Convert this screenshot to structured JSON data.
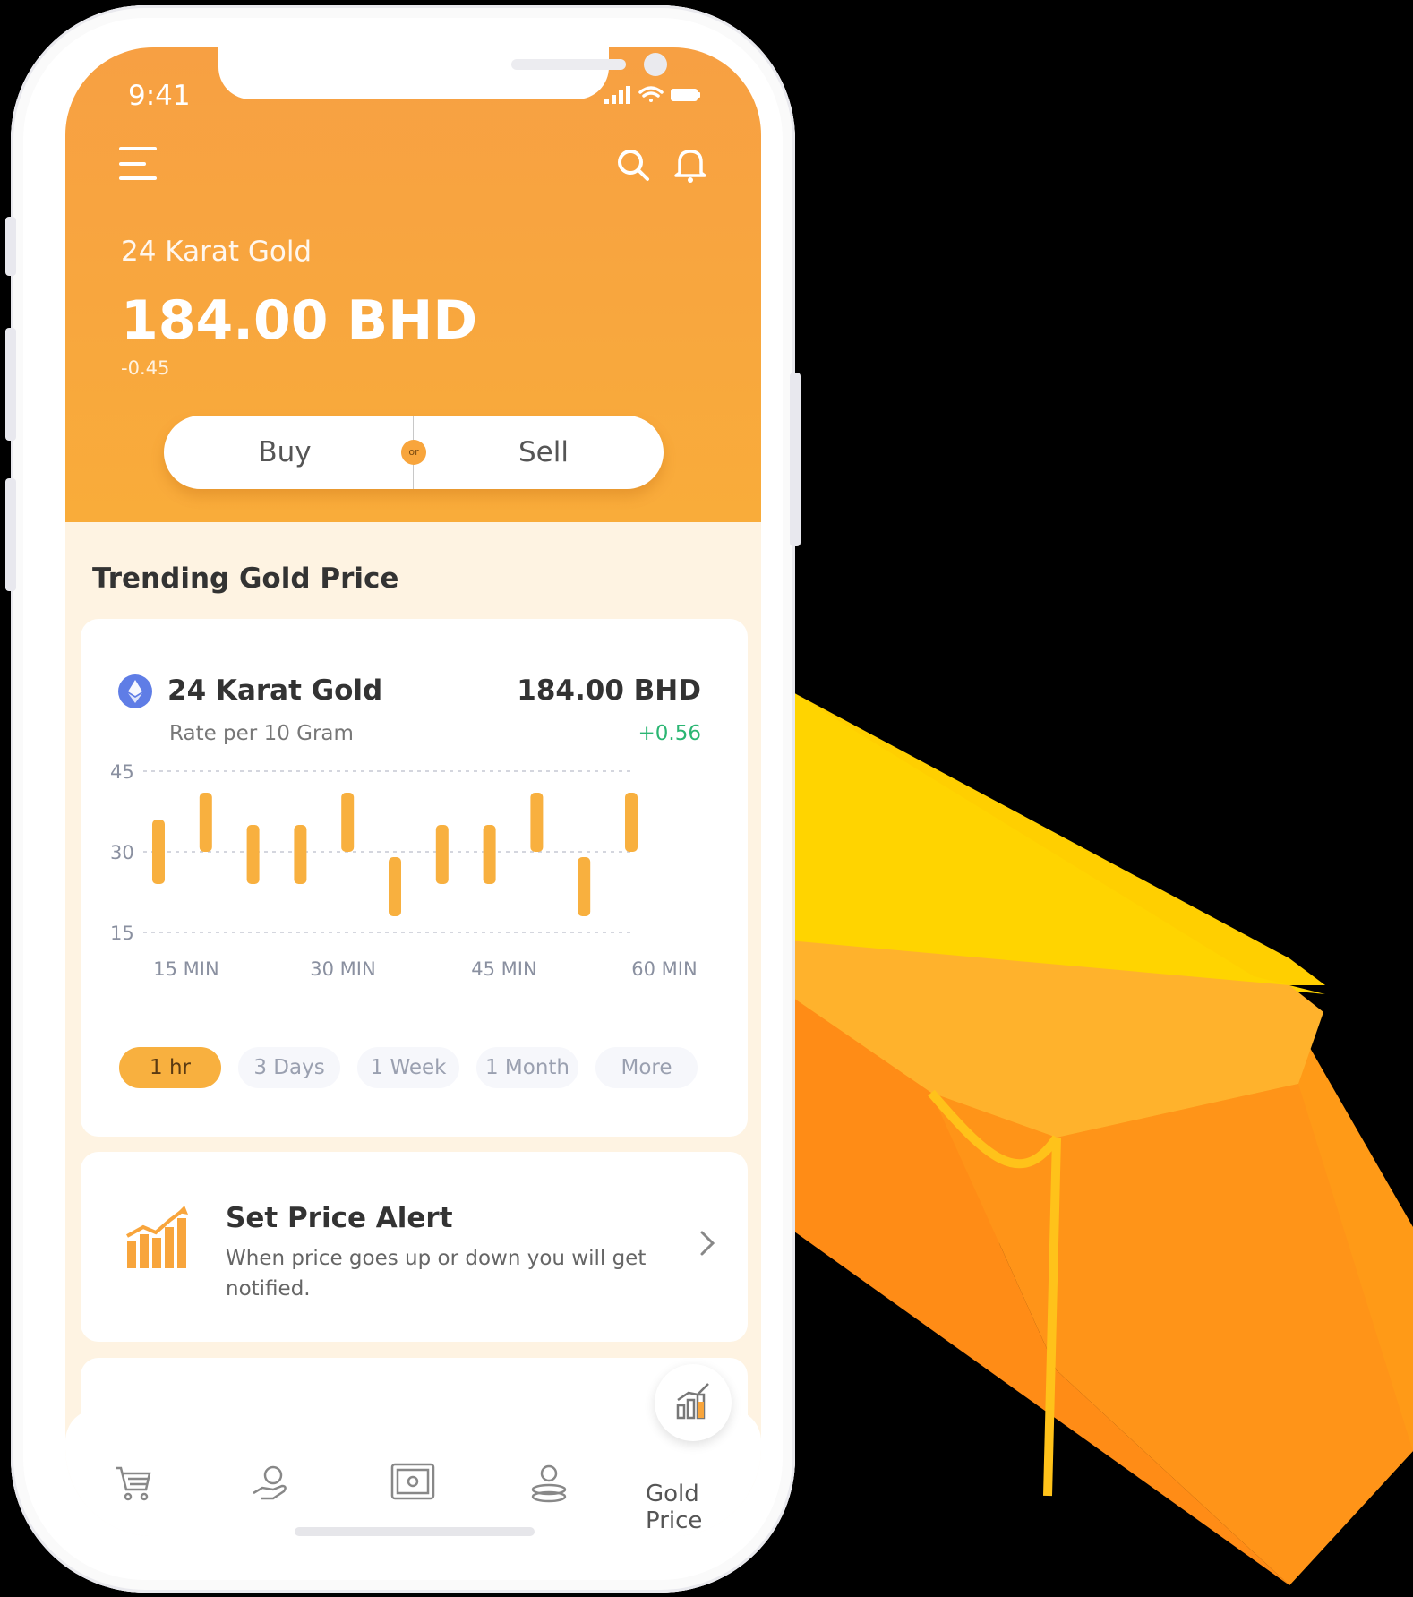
{
  "status_bar": {
    "time": "9:41"
  },
  "header": {
    "menu_icon": "hamburger-icon",
    "search_icon": "search-icon",
    "bell_icon": "bell-icon",
    "subtitle": "24 Karat Gold",
    "price": "184.00 BHD",
    "change": "-0.45"
  },
  "trade": {
    "buy_label": "Buy",
    "or_label": "or",
    "sell_label": "Sell"
  },
  "section_title": "Trending Gold Price",
  "price_card": {
    "icon": "ethereum-icon",
    "title": "24 Karat Gold",
    "price": "184.00 BHD",
    "subtitle": "Rate per 10 Gram",
    "change": "+0.56"
  },
  "chart_data": {
    "type": "bar",
    "ylim": [
      15,
      45
    ],
    "y_ticks": [
      45,
      30,
      15
    ],
    "x_tick_labels": [
      "15 MIN",
      "30 MIN",
      "45 MIN",
      "60 MIN"
    ],
    "series": [
      {
        "values": [
          [
            24,
            36
          ],
          [
            30,
            41
          ],
          [
            24,
            35
          ],
          [
            24,
            35
          ],
          [
            30,
            41
          ],
          [
            18,
            29
          ],
          [
            24,
            35
          ],
          [
            24,
            35
          ],
          [
            30,
            41
          ],
          [
            18,
            29
          ],
          [
            30,
            41
          ]
        ]
      }
    ],
    "bar_color": "#f8b03f",
    "grid": true
  },
  "ranges": [
    {
      "label": "1 hr",
      "active": true
    },
    {
      "label": "3 Days",
      "active": false
    },
    {
      "label": "1 Week",
      "active": false
    },
    {
      "label": "1 Month",
      "active": false
    },
    {
      "label": "More",
      "active": false
    }
  ],
  "alert": {
    "icon": "rising-chart-icon",
    "title": "Set Price Alert",
    "text": "When price goes up or down you will get notified."
  },
  "nav": {
    "items": [
      "cart-icon",
      "hand-coin-icon",
      "safe-icon",
      "coin-stack-icon",
      "gold-price-icon"
    ],
    "active_label": "Gold Price"
  },
  "colors": {
    "accent": "#f8a53c",
    "positive": "#2bb673",
    "background": "#fef3e2"
  }
}
